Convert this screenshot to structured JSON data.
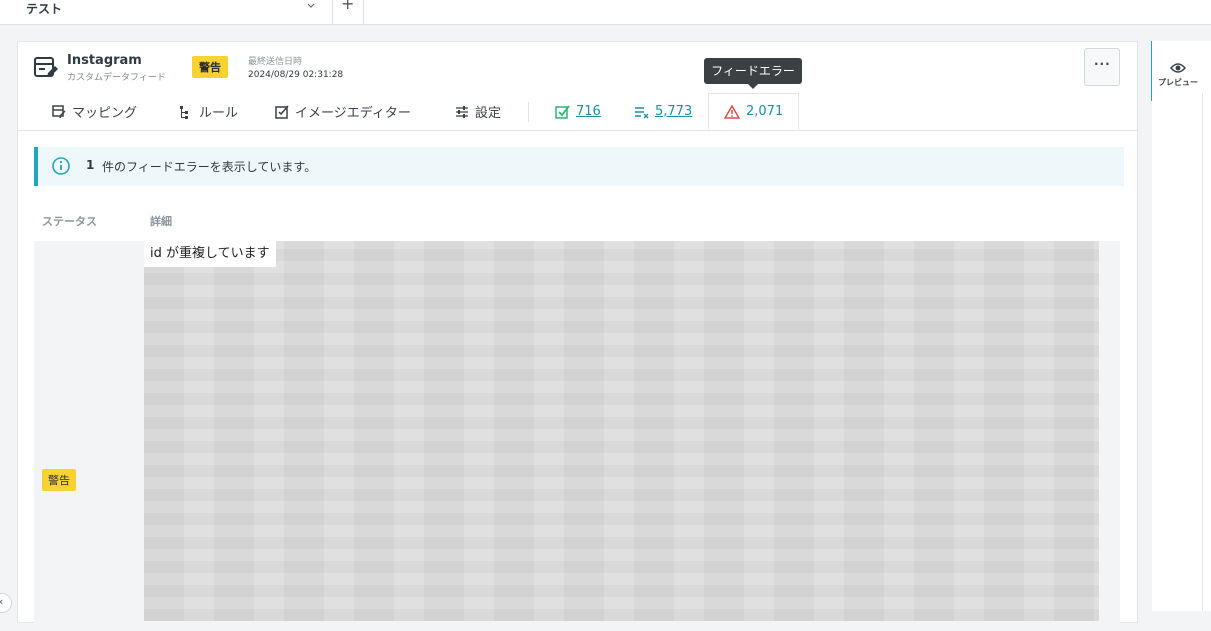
{
  "project": {
    "tab_label": "テスト",
    "add_label": "+"
  },
  "feed": {
    "name": "Instagram",
    "type": "カスタムデータフィード",
    "status_badge": "警告",
    "last_sent_label": "最終送信日時",
    "last_sent_value": "2024/08/29 02:31:28",
    "more_label": "···"
  },
  "tooltip": "フィードエラー",
  "tabs": [
    {
      "label": "マッピング",
      "icon": "mapping-icon"
    },
    {
      "label": "ルール",
      "icon": "rule-icon"
    },
    {
      "label": "イメージエディター",
      "icon": "image-editor-icon"
    },
    {
      "label": "設定",
      "icon": "settings-sliders-icon"
    }
  ],
  "metrics": {
    "success": "716",
    "excluded": "5,773",
    "errors": "2,071"
  },
  "info": {
    "count": "1",
    "message": "件のフィードエラーを表示しています。"
  },
  "table": {
    "headers": [
      "ステータス",
      "詳細"
    ],
    "rows": [
      {
        "status": "警告",
        "detail": "id が重複しています"
      }
    ]
  },
  "rail": {
    "preview_label": "プレビュー"
  },
  "colors": {
    "accent": "#22a5c2",
    "warning": "#f7d230",
    "success": "#2bb673",
    "error": "#e04d4d"
  }
}
